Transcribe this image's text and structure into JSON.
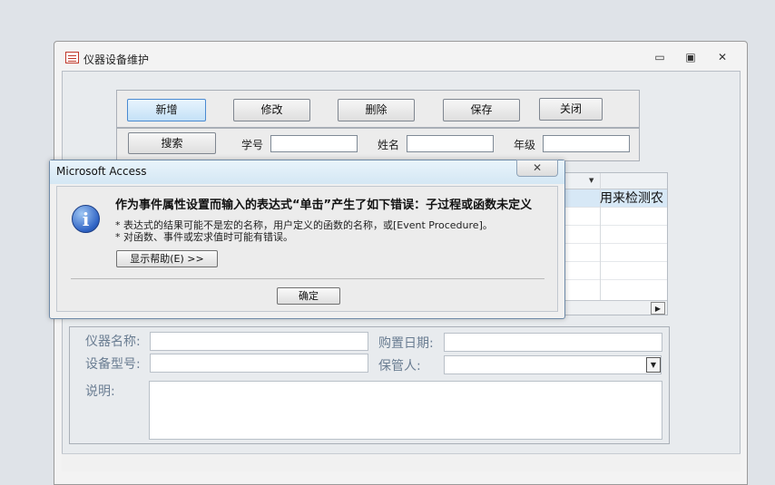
{
  "window": {
    "title": "仪器设备维护",
    "min_glyph": "▭",
    "restore_glyph": "▣",
    "close_glyph": "✕"
  },
  "toolbar": {
    "add_label": "新增",
    "edit_label": "修改",
    "delete_label": "删除",
    "save_label": "保存",
    "close_label": "关闭"
  },
  "search": {
    "search_label": "搜索",
    "student_id_label": "学号",
    "student_id_value": "",
    "name_label": "姓名",
    "name_value": "",
    "grade_label": "年级",
    "grade_value": ""
  },
  "grid": {
    "visible_cell": "用来检测农"
  },
  "detail": {
    "device_name_label": "仪器名称:",
    "device_name_value": "",
    "purchase_date_label": "购置日期:",
    "purchase_date_value": "",
    "model_label": "设备型号:",
    "model_value": "",
    "keeper_label": "保管人:",
    "keeper_value": "",
    "description_label": "说明:",
    "description_value": ""
  },
  "dialog": {
    "title": "Microsoft Access",
    "close_glyph": "✕",
    "message": "作为事件属性设置而输入的表达式“单击”产生了如下错误：子过程或函数未定义",
    "line1": "* 表达式的结果可能不是宏的名称，用户定义的函数的名称，或[Event Procedure]。",
    "line2": "* 对函数、事件或宏求值时可能有错误。",
    "help_label": "显示帮助(E) >>",
    "ok_label": "确定"
  },
  "icons": {
    "info": "i",
    "dropdown": "▼",
    "scroll_right": "▶"
  },
  "colors": {
    "accent": "#4a8ad1",
    "detail_label": "#6a7d92"
  }
}
